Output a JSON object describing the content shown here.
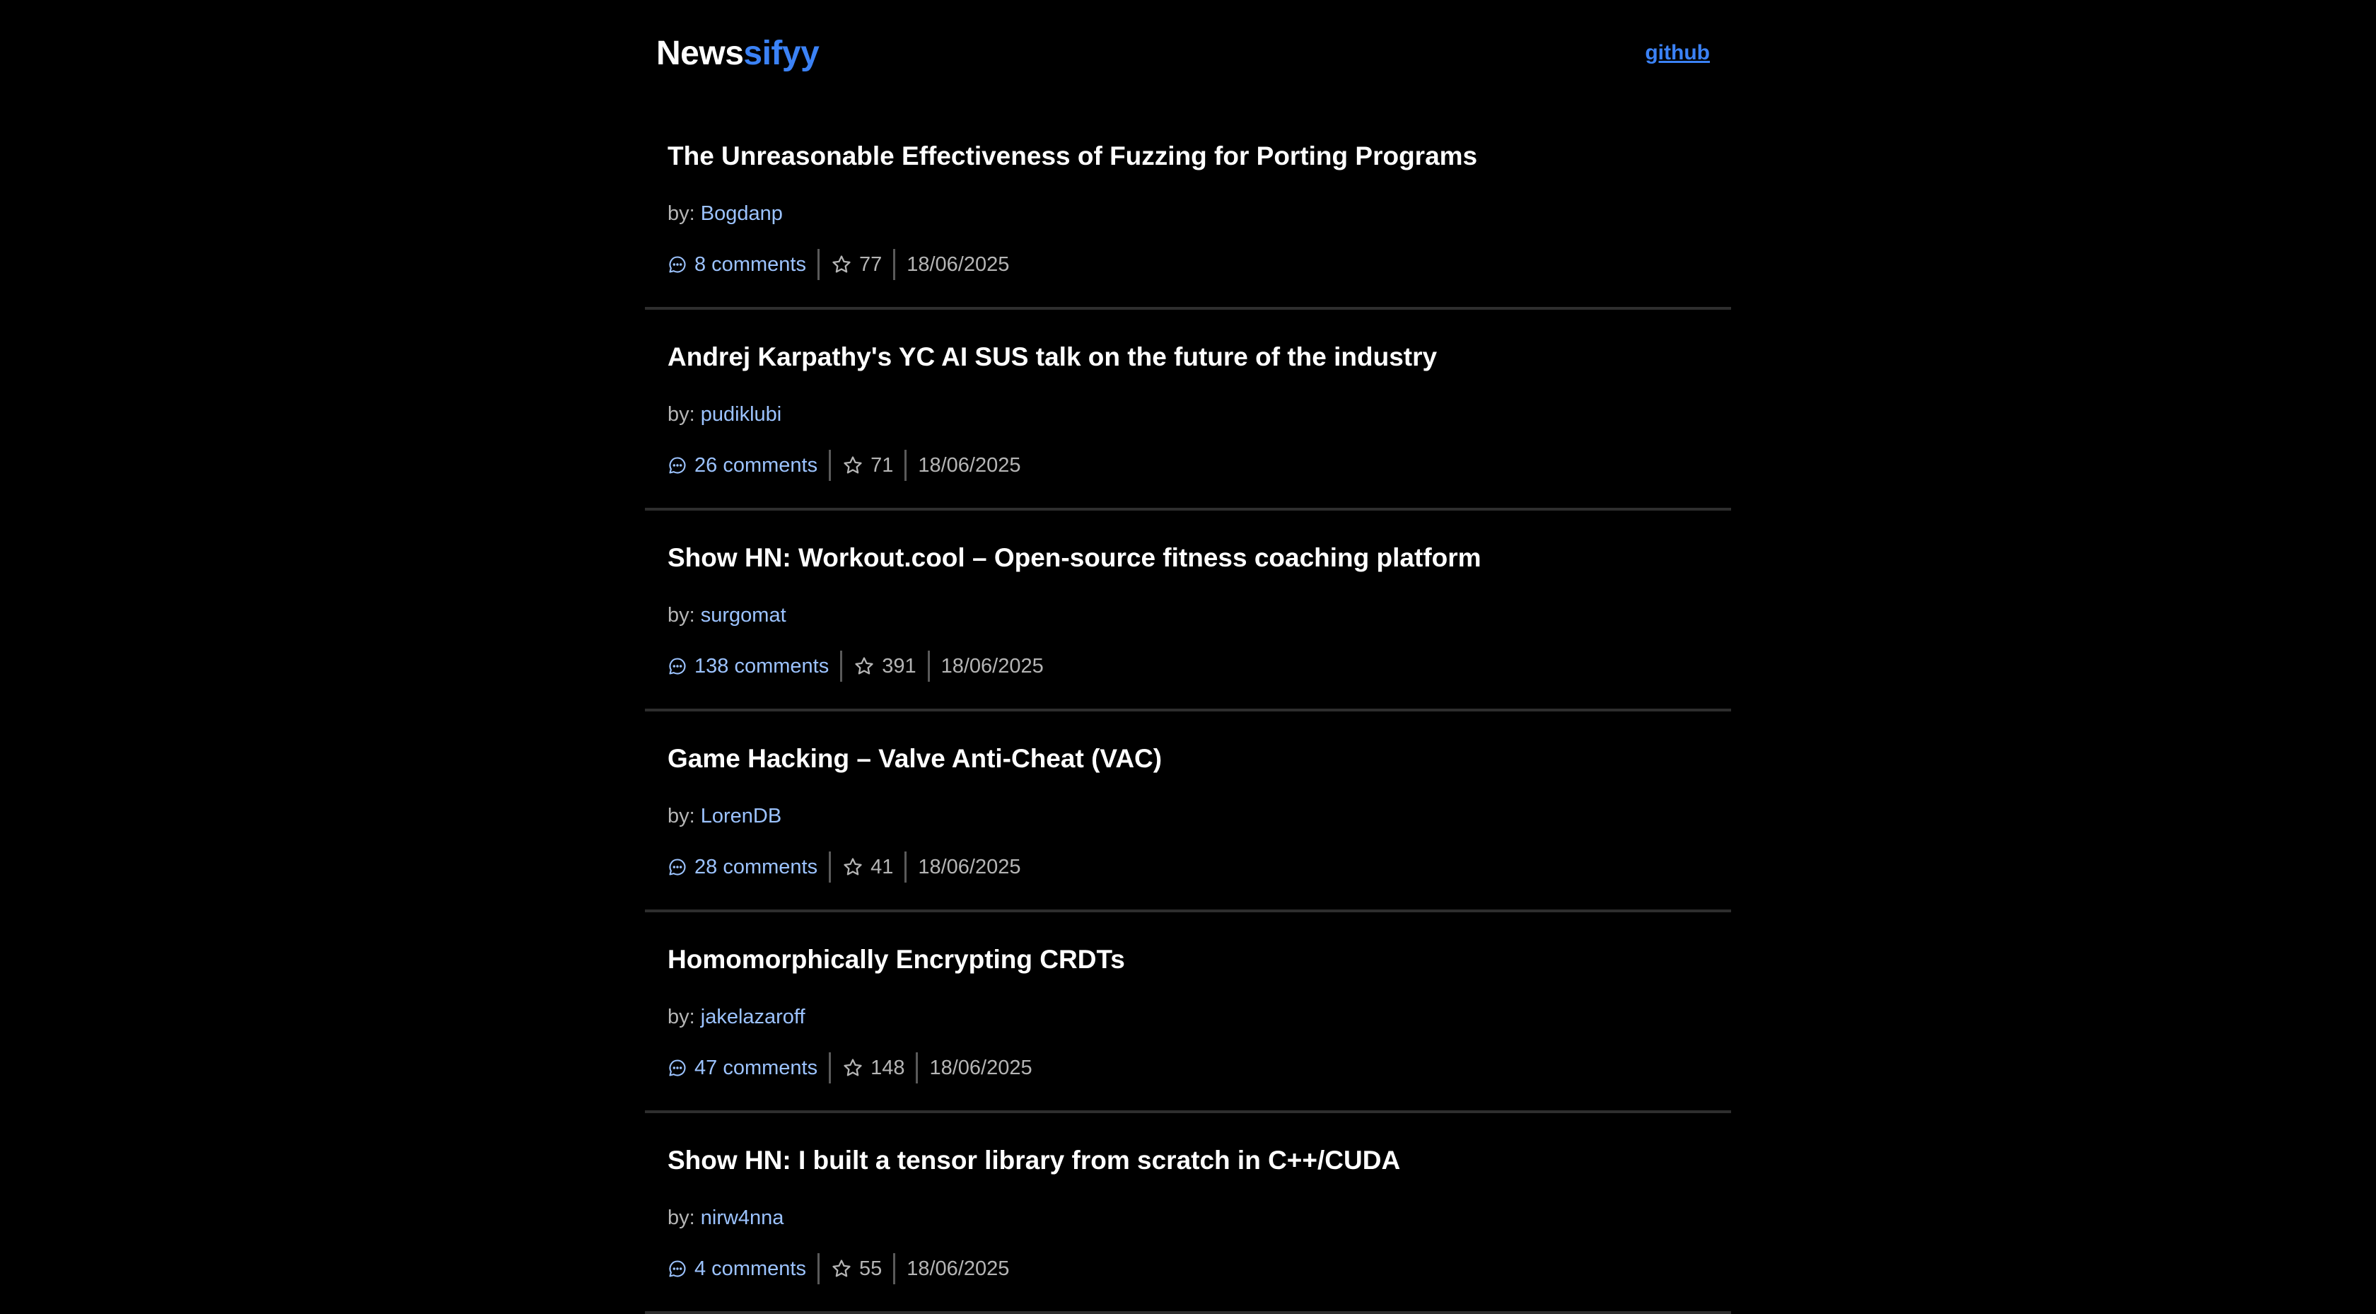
{
  "header": {
    "brand_part1": "News",
    "brand_part2": "sifyy",
    "github_label": "github",
    "accent_color": "#3b82f6"
  },
  "labels": {
    "by": "by:"
  },
  "stories": [
    {
      "title": "The Unreasonable Effectiveness of Fuzzing for Porting Programs",
      "author": "Bogdanp",
      "comments": "8 comments",
      "score": "77",
      "date": "18/06/2025"
    },
    {
      "title": "Andrej Karpathy's YC AI SUS talk on the future of the industry",
      "author": "pudiklubi",
      "comments": "26 comments",
      "score": "71",
      "date": "18/06/2025"
    },
    {
      "title": "Show HN: Workout.cool – Open-source fitness coaching platform",
      "author": "surgomat",
      "comments": "138 comments",
      "score": "391",
      "date": "18/06/2025"
    },
    {
      "title": "Game Hacking – Valve Anti-Cheat (VAC)",
      "author": "LorenDB",
      "comments": "28 comments",
      "score": "41",
      "date": "18/06/2025"
    },
    {
      "title": "Homomorphically Encrypting CRDTs",
      "author": "jakelazaroff",
      "comments": "47 comments",
      "score": "148",
      "date": "18/06/2025"
    },
    {
      "title": "Show HN: I built a tensor library from scratch in C++/CUDA",
      "author": "nirw4nna",
      "comments": "4 comments",
      "score": "55",
      "date": "18/06/2025"
    }
  ]
}
